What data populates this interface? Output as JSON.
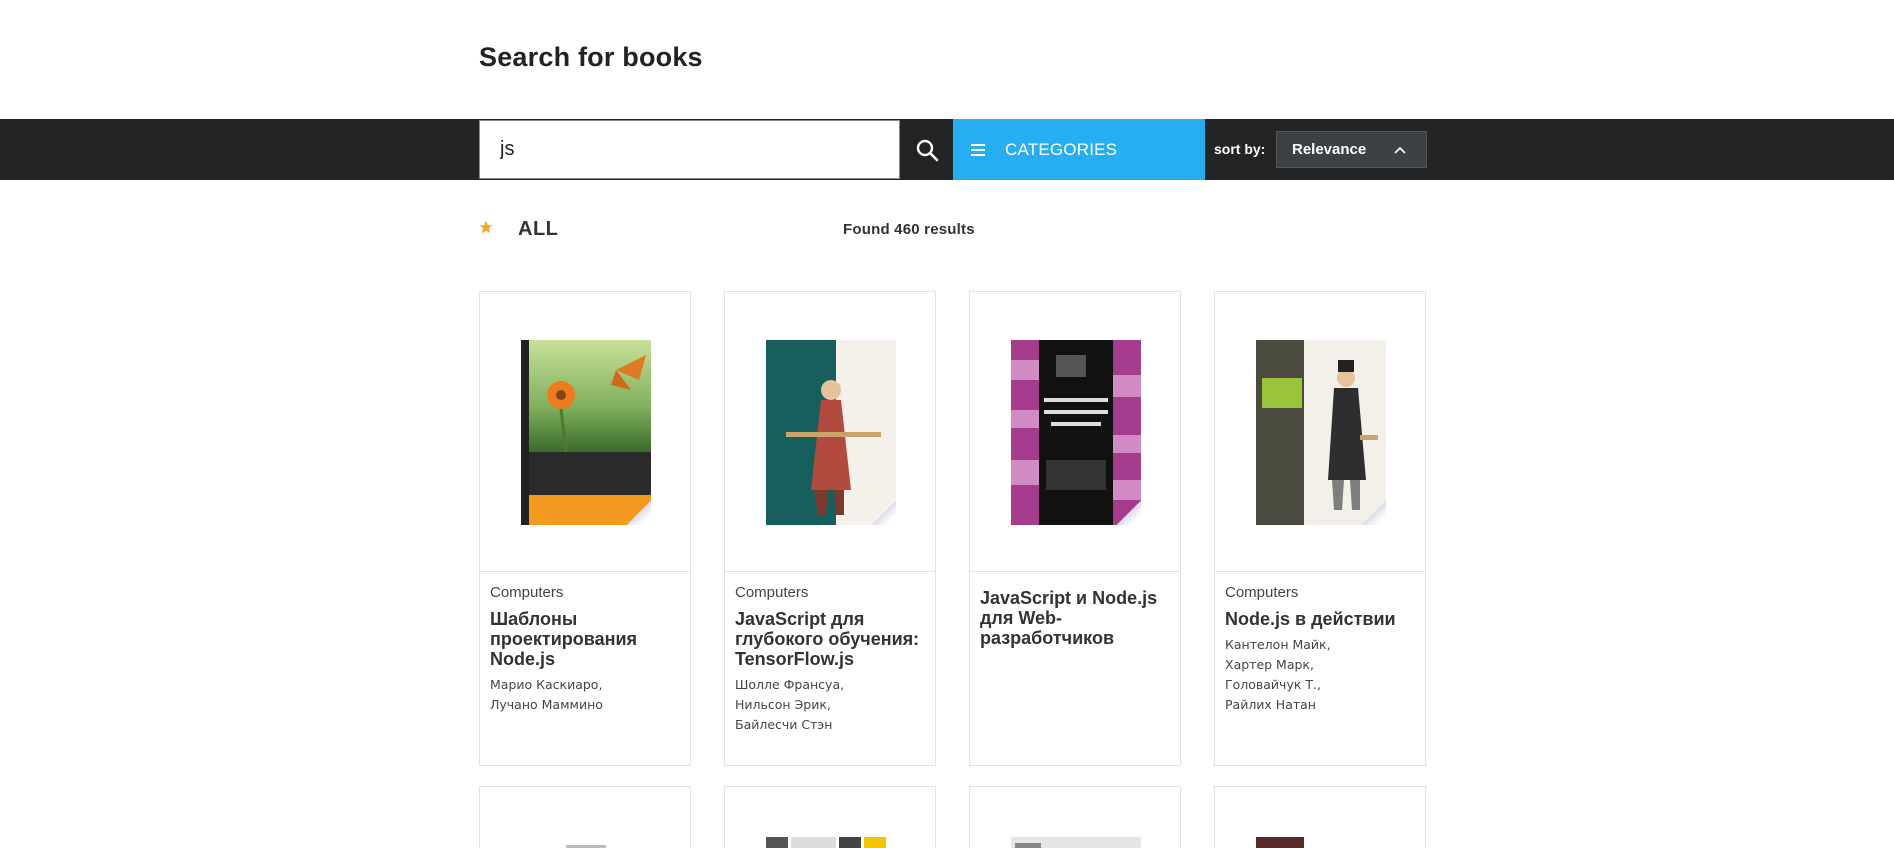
{
  "page": {
    "title": "Search for books"
  },
  "toolbar": {
    "search_value": "js",
    "search_icon": "search-icon",
    "categories_label": "CATEGORIES",
    "sort_label": "sort by:",
    "sort_value": "Relevance"
  },
  "filter": {
    "label": "ALL",
    "results_text": "Found 460 results"
  },
  "colors": {
    "accent": "#27aef2",
    "toolbar_bg": "#222426",
    "star": "#f5a623"
  },
  "books": [
    {
      "category": "Computers",
      "title": "Шаблоны проектирования Node.js",
      "authors": [
        "Марио Каскиаро,",
        "Лучано Маммино"
      ]
    },
    {
      "category": "Computers",
      "title": "JavaScript для глубокого обучения: TensorFlow.js",
      "authors": [
        "Шолле Франсуа,",
        "Нильсон Эрик,",
        "Байлесчи Стэн"
      ]
    },
    {
      "category": "",
      "title": "JavaScript и Node.js для Web-разработчиков",
      "authors": []
    },
    {
      "category": "Computers",
      "title": "Node.js в действии",
      "authors": [
        "Кантелон Майк,",
        "Хартер Марк,",
        "Головайчук Т.,",
        "Райлих Натан"
      ]
    }
  ]
}
